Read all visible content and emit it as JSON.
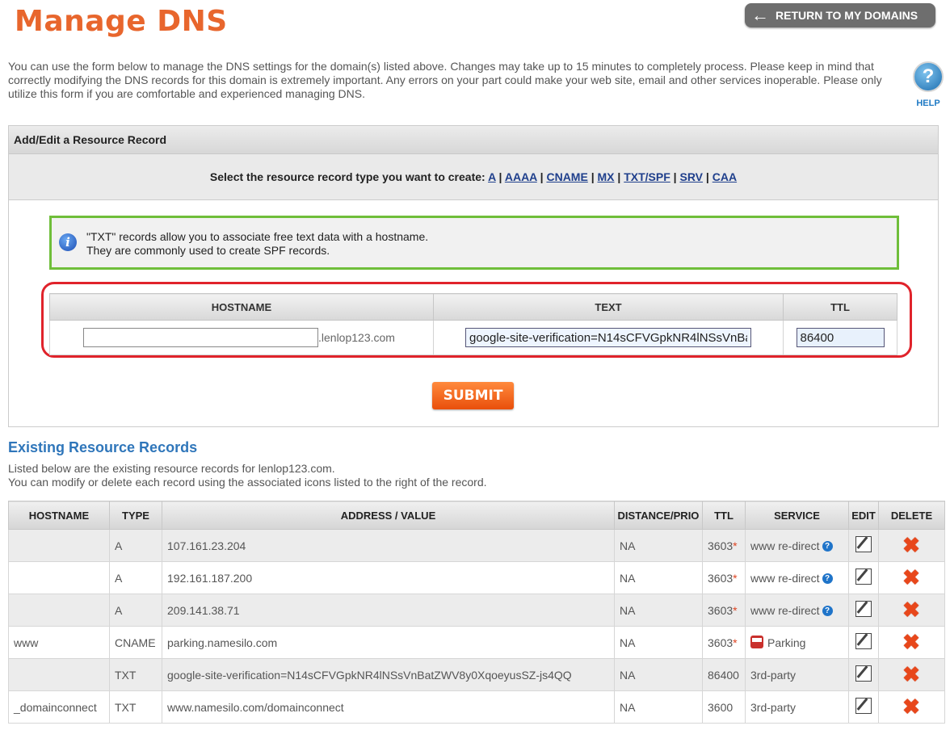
{
  "page": {
    "title": "Manage DNS",
    "return_label": "RETURN TO MY DOMAINS",
    "intro": "You can use the form below to manage the DNS settings for the domain(s) listed above. Changes may take up to 15 minutes to completely process. Please keep in mind that correctly modifying the DNS records for this domain is extremely important. Any errors on your part could make your web site, email and other services inoperable. Please only utilize this form if you are comfortable and experienced managing DNS.",
    "help_label": "HELP"
  },
  "form": {
    "panel_title": "Add/Edit a Resource Record",
    "select_prompt": "Select the resource record type you want to create:",
    "record_types": [
      "A",
      "AAAA",
      "CNAME",
      "MX",
      "TXT/SPF",
      "SRV",
      "CAA"
    ],
    "info_line1": "\"TXT\" records allow you to associate free text data with a hostname.",
    "info_line2": "They are commonly used to create SPF records.",
    "col_hostname": "HOSTNAME",
    "col_text": "TEXT",
    "col_ttl": "TTL",
    "hostname_value": "",
    "domain_suffix": ".lenlop123.com",
    "text_value": "google-site-verification=N14sCFVGpkNR4lNSsVnBatZWV8y0XqoeyusSZ-js4QQ",
    "ttl_value": "86400",
    "submit_label": "SUBMIT"
  },
  "existing": {
    "title": "Existing Resource Records",
    "desc_line1": "Listed below are the existing resource records for lenlop123.com.",
    "desc_line2": "You can modify or delete each record using the associated icons listed to the right of the record.",
    "headers": [
      "HOSTNAME",
      "TYPE",
      "ADDRESS / VALUE",
      "DISTANCE/PRIO",
      "TTL",
      "SERVICE",
      "EDIT",
      "DELETE"
    ],
    "rows": [
      {
        "hostname": "",
        "type": "A",
        "value": "107.161.23.204",
        "prio": "NA",
        "ttl": "3603",
        "ttl_star": "*",
        "service": "www re-direct",
        "service_help": "?",
        "service_icon": ""
      },
      {
        "hostname": "",
        "type": "A",
        "value": "192.161.187.200",
        "prio": "NA",
        "ttl": "3603",
        "ttl_star": "*",
        "service": "www re-direct",
        "service_help": "?",
        "service_icon": ""
      },
      {
        "hostname": "",
        "type": "A",
        "value": "209.141.38.71",
        "prio": "NA",
        "ttl": "3603",
        "ttl_star": "*",
        "service": "www re-direct",
        "service_help": "?",
        "service_icon": ""
      },
      {
        "hostname": "www",
        "type": "CNAME",
        "value": "parking.namesilo.com",
        "prio": "NA",
        "ttl": "3603",
        "ttl_star": "*",
        "service": "Parking",
        "service_help": "",
        "service_icon": "bus-icon"
      },
      {
        "hostname": "",
        "type": "TXT",
        "value": "google-site-verification=N14sCFVGpkNR4lNSsVnBatZWV8y0XqoeyusSZ-js4QQ",
        "prio": "NA",
        "ttl": "86400",
        "ttl_star": "",
        "service": "3rd-party",
        "service_help": "",
        "service_icon": ""
      },
      {
        "hostname": "_domainconnect",
        "type": "TXT",
        "value": "www.namesilo.com/domainconnect",
        "prio": "NA",
        "ttl": "3600",
        "ttl_star": "",
        "service": "3rd-party",
        "service_help": "",
        "service_icon": ""
      }
    ]
  },
  "colors": {
    "accent_orange": "#e8662d",
    "link_blue": "#2f76ba",
    "highlight_red": "#e0232b",
    "info_green": "#6fbe3a"
  }
}
